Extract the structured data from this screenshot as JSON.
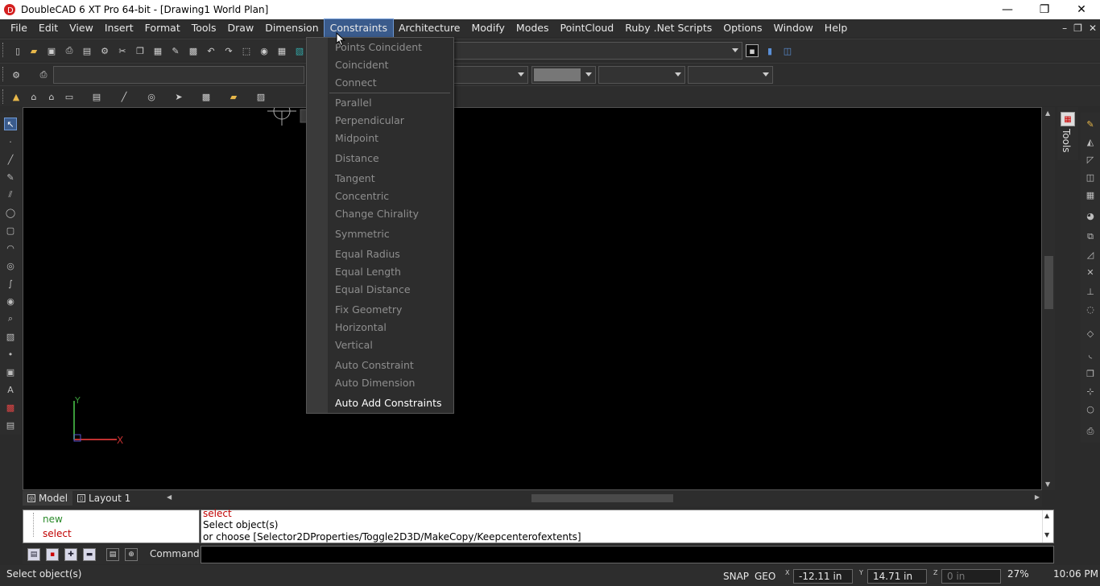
{
  "window": {
    "title": "DoubleCAD 6 XT Pro 64-bit - [Drawing1 World Plan]",
    "minimize": "—",
    "restore": "❐",
    "close": "✕"
  },
  "menubar": {
    "items": [
      "File",
      "Edit",
      "View",
      "Insert",
      "Format",
      "Tools",
      "Draw",
      "Dimension",
      "Constraints",
      "Architecture",
      "Modify",
      "Modes",
      "PointCloud",
      "Ruby .Net Scripts",
      "Options",
      "Window",
      "Help"
    ],
    "active": "Constraints",
    "mdi": {
      "minimize": "–",
      "restore": "❐",
      "close": "✕"
    }
  },
  "constraints_menu": {
    "items": [
      {
        "label": "Points Coincident",
        "enabled": false
      },
      {
        "label": "Coincident",
        "enabled": false
      },
      {
        "label": "Connect",
        "enabled": false
      },
      {
        "label": "Parallel",
        "enabled": false
      },
      {
        "label": "Perpendicular",
        "enabled": false
      },
      {
        "label": "Midpoint",
        "enabled": false
      },
      {
        "label": "Distance",
        "enabled": false
      },
      {
        "label": "Tangent",
        "enabled": false
      },
      {
        "label": "Concentric",
        "enabled": false
      },
      {
        "label": "Change Chirality",
        "enabled": false
      },
      {
        "label": "Symmetric",
        "enabled": false
      },
      {
        "label": "Equal Radius",
        "enabled": false
      },
      {
        "label": "Equal Length",
        "enabled": false
      },
      {
        "label": "Equal Distance",
        "enabled": false
      },
      {
        "label": "Fix Geometry",
        "enabled": false
      },
      {
        "label": "Horizontal",
        "enabled": false
      },
      {
        "label": "Vertical",
        "enabled": false
      },
      {
        "label": "Auto Constraint",
        "enabled": false
      },
      {
        "label": "Auto Dimension",
        "enabled": false
      },
      {
        "label": "Auto Add Constraints",
        "enabled": true
      }
    ]
  },
  "tabs": {
    "model": "Model",
    "layout1": "Layout 1"
  },
  "side_panel": {
    "tools_label": "Tools"
  },
  "history": {
    "new": "new",
    "select": "select"
  },
  "command_log": {
    "line1": "select",
    "line2": "Select object(s)",
    "line3": " or choose [Selector2DProperties/Toggle2D3D/MakeCopy/Keepcenterofextents]"
  },
  "command": {
    "label": "Command:",
    "value": ""
  },
  "status": {
    "message": "Select object(s)",
    "snap": "SNAP",
    "geo": "GEO",
    "x_tag": "X",
    "x_value": "-12.11 in",
    "y_tag": "Y",
    "y_value": "14.71 in",
    "z_tag": "Z",
    "z_value": "0 in",
    "zoom": "27%",
    "time": "10:06 PM"
  },
  "axes": {
    "x_label": "X",
    "y_label": "Y"
  },
  "colors": {
    "menu_highlight": "#3a5b8c",
    "canvas": "#000000",
    "history_new": "#2a8a2a",
    "history_select": "#c00000"
  }
}
